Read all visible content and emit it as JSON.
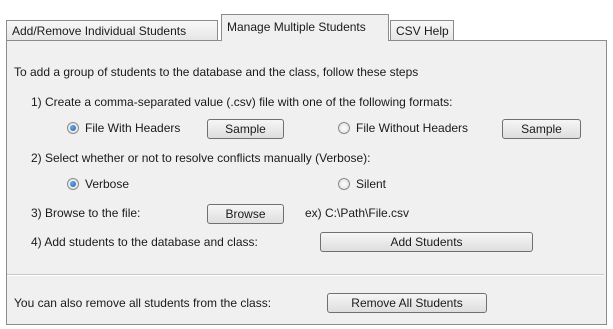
{
  "tabs": [
    {
      "label": "Add/Remove Individual Students",
      "active": false
    },
    {
      "label": "Manage Multiple Students",
      "active": true
    },
    {
      "label": "CSV Help",
      "active": false
    }
  ],
  "intro": "To add a group of students to the database and the class, follow these steps",
  "step1": {
    "label": "1) Create a comma-separated value (.csv) file with one of the following formats:",
    "options": [
      {
        "label": "File With Headers",
        "selected": true,
        "sample_label": "Sample"
      },
      {
        "label": "File Without Headers",
        "selected": false,
        "sample_label": "Sample"
      }
    ]
  },
  "step2": {
    "label": "2) Select whether or not to resolve conflicts manually (Verbose):",
    "options": [
      {
        "label": "Verbose",
        "selected": true
      },
      {
        "label": "Silent",
        "selected": false
      }
    ]
  },
  "step3": {
    "label": "3) Browse to the file:",
    "button": "Browse",
    "example": "ex) C:\\Path\\File.csv"
  },
  "step4": {
    "label": "4) Add students to the database and class:",
    "button": "Add Students"
  },
  "remove": {
    "label": "You can also remove all students from the class:",
    "button": "Remove All Students"
  },
  "colors": {
    "panel_bg": "#f0f0f0",
    "border": "#8c8c8c",
    "radio_selected": "#1f5fae"
  }
}
